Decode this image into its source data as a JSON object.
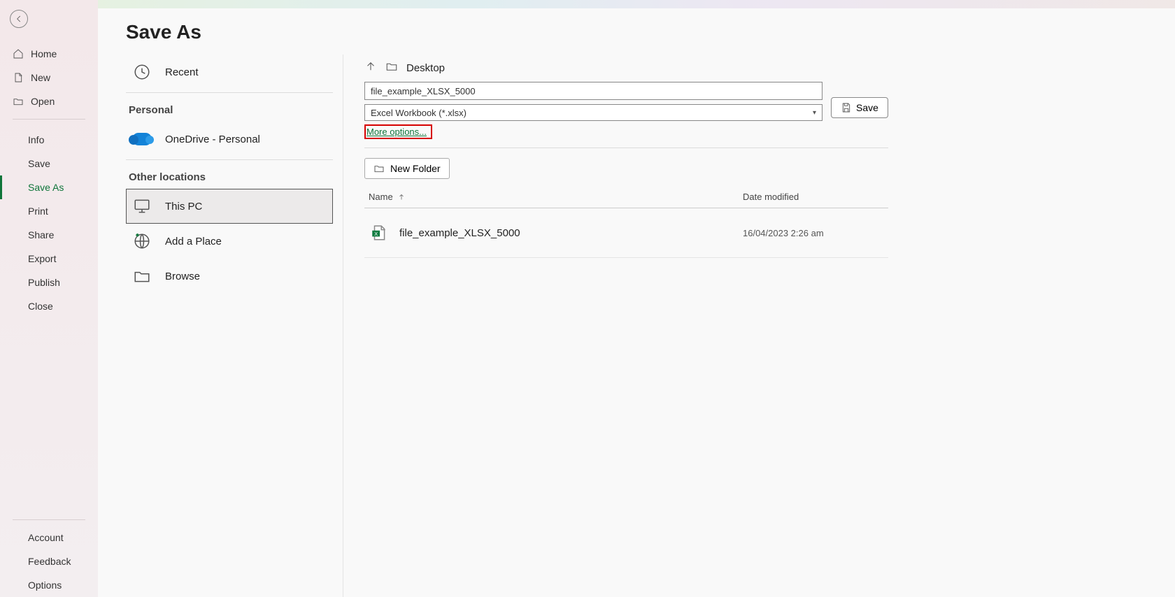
{
  "sidebar": {
    "home": "Home",
    "new": "New",
    "open": "Open",
    "items": [
      "Info",
      "Save",
      "Save As",
      "Print",
      "Share",
      "Export",
      "Publish",
      "Close"
    ],
    "active_index": 2,
    "bottom": [
      "Account",
      "Feedback",
      "Options"
    ]
  },
  "page": {
    "title": "Save As"
  },
  "locations": {
    "recent": "Recent",
    "personal_heading": "Personal",
    "onedrive": "OneDrive - Personal",
    "other_heading": "Other locations",
    "thispc": "This PC",
    "addplace": "Add a Place",
    "browse": "Browse"
  },
  "details": {
    "path": "Desktop",
    "filename": "file_example_XLSX_5000",
    "filetype": "Excel Workbook (*.xlsx)",
    "more_options": "More options...",
    "save_label": "Save",
    "newfolder_label": "New Folder",
    "columns": {
      "name": "Name",
      "date": "Date modified"
    },
    "files": [
      {
        "name": "file_example_XLSX_5000",
        "date": "16/04/2023 2:26 am"
      }
    ]
  }
}
